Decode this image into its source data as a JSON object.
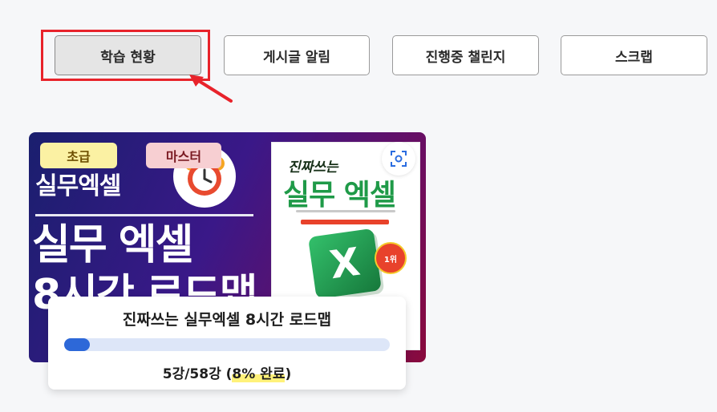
{
  "tabs": [
    {
      "label": "학습 현황",
      "active": true
    },
    {
      "label": "게시글 알림",
      "active": false
    },
    {
      "label": "진행중 챌린지",
      "active": false
    },
    {
      "label": "스크랩",
      "active": false
    }
  ],
  "course": {
    "badges": {
      "level": "초급",
      "master": "마스터"
    },
    "thumbnail": {
      "small_title": "실무엑셀",
      "big_title_line1": "실무 엑셀",
      "big_title_line2": "8시간 로드맵"
    },
    "book": {
      "subtitle": "진짜쓰는",
      "title": "실무 엑셀",
      "icon_letter": "X",
      "rank": "1위"
    },
    "title": "진짜쓰는 실무엑셀 8시간 로드맵",
    "progress": {
      "fraction": 0.08,
      "lessons_text": "5강/58강 (",
      "percent_text": "8% 완료",
      "close_paren": ")"
    }
  },
  "colors": {
    "highlight": "#e8232b",
    "progress_fill": "#2d68d8",
    "progress_track": "#dde6f8",
    "text_highlight": "#fff27a"
  }
}
